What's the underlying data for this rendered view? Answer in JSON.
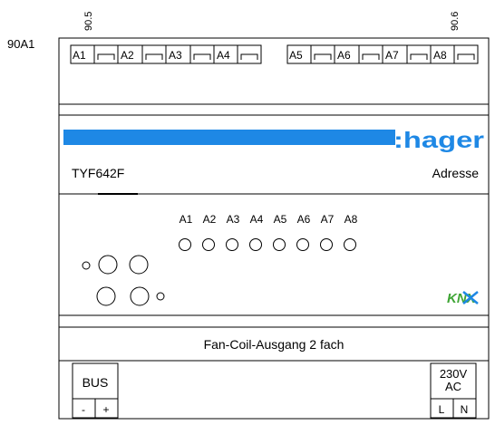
{
  "device_label": "90A1",
  "terminal_groups": [
    {
      "code": "90.5",
      "terminals": [
        "A1",
        "A2",
        "A3",
        "A4"
      ]
    },
    {
      "code": "90.6",
      "terminals": [
        "A5",
        "A6",
        "A7",
        "A8"
      ]
    }
  ],
  "brand": {
    "name": ":hager",
    "color": "#1e88e5"
  },
  "model": "TYF642F",
  "address_label": "Adresse",
  "leds": {
    "labels": [
      "A1",
      "A2",
      "A3",
      "A4",
      "A5",
      "A6",
      "A7",
      "A8"
    ]
  },
  "knx_logo": {
    "text": "KNX",
    "colors": [
      "#3fa535",
      "#1e88e5"
    ]
  },
  "description": "Fan-Coil-Ausgang 2 fach",
  "bus_block": {
    "label": "BUS",
    "minus": "-",
    "plus": "+"
  },
  "power_block": {
    "voltage": "230V",
    "type": "AC",
    "l": "L",
    "n": "N"
  },
  "colors": {
    "line": "#000000",
    "brand_bar": "#1e88e5",
    "background": "#ffffff"
  }
}
